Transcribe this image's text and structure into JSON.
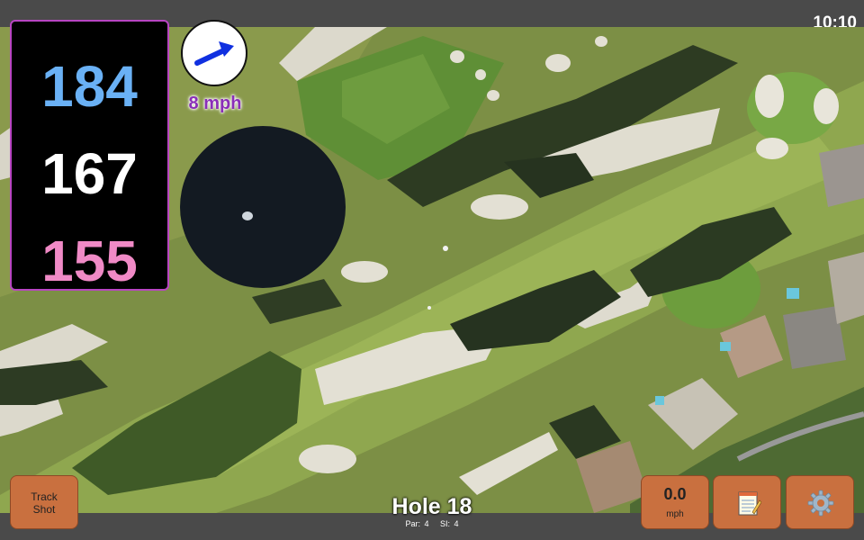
{
  "status_bar": {
    "time": "10:10"
  },
  "distances": {
    "back": "184",
    "middle": "167",
    "front": "155",
    "colors": {
      "back": "#6ab1f5",
      "middle": "#ffffff",
      "front": "#f08ac6",
      "panel_border": "#b845c2"
    }
  },
  "wind": {
    "speed_label": "8 mph",
    "icon": "wind-arrow-icon",
    "arrow_color": "#1030e0",
    "label_color": "#8a2eb8"
  },
  "buttons": {
    "track_shot_line1": "Track",
    "track_shot_line2": "Shot",
    "speed_value": "0.0",
    "speed_unit": "mph",
    "notes_icon": "notepad-icon",
    "settings_icon": "gear-icon",
    "button_color": "#c9703f"
  },
  "hole": {
    "title": "Hole 18",
    "par": "Par: 4",
    "si": "SI: 4"
  }
}
